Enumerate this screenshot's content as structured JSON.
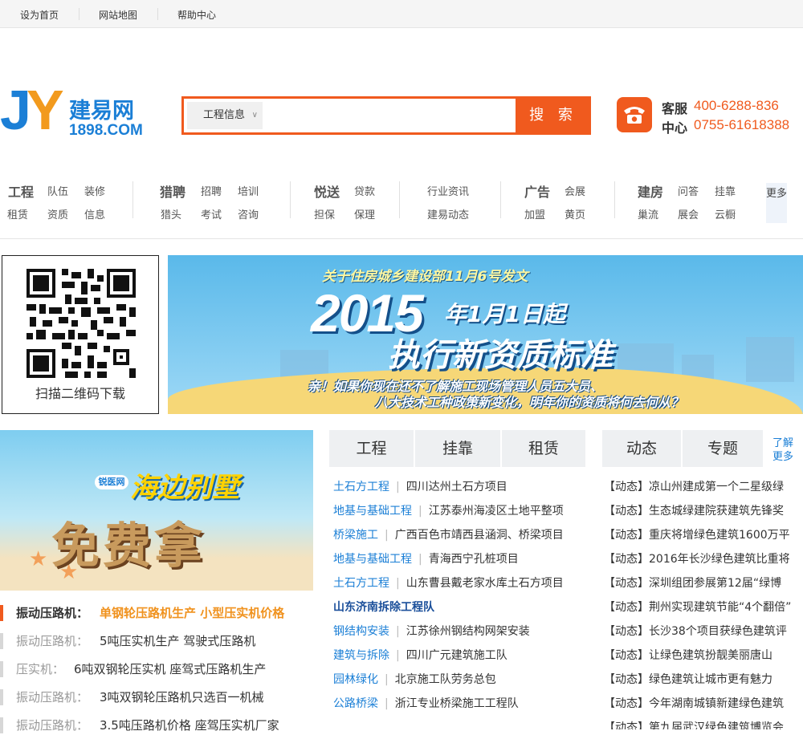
{
  "topbar": {
    "set_home": "设为首页",
    "sitemap": "网站地图",
    "help": "帮助中心"
  },
  "logo": {
    "mark_j": "J",
    "mark_y": "Y",
    "name_cn": "建易网",
    "name_en": "1898.COM"
  },
  "search": {
    "category": "工程信息",
    "placeholder": "",
    "button": "搜 索"
  },
  "service": {
    "label1": "客服",
    "label2": "中心",
    "tel1": "400-6288-836",
    "tel2": "0755-61618388"
  },
  "nav": {
    "groups": [
      {
        "head": "工程",
        "links": [
          "队伍",
          "装修",
          "租赁",
          "资质",
          "信息"
        ]
      },
      {
        "head": "猎聘",
        "links": [
          "招聘",
          "培训",
          "猎头",
          "考试",
          "咨询"
        ]
      },
      {
        "head": "悦送",
        "links": [
          "贷款",
          "担保",
          "保理"
        ]
      },
      {
        "head": "",
        "links": [
          "行业资讯",
          "建易动态"
        ]
      },
      {
        "head": "广告",
        "links": [
          "会展",
          "加盟",
          "黄页"
        ]
      },
      {
        "head": "建房",
        "links": [
          "问答",
          "挂靠",
          "巢流",
          "展会",
          "云橱"
        ]
      }
    ],
    "more": "更多"
  },
  "qr": {
    "caption": "扫描二维码下载"
  },
  "banner": {
    "line1": "关于住房城乡建设部11月6号发文",
    "year": "2015",
    "date": "年1月1日起",
    "headline": "执行新资质标准",
    "sub1": "亲！如果你现在还不了解施工现场管理人员五大员、",
    "sub2": "八大技术工种政策新变化，明年你的资质将何去何从？"
  },
  "promo": {
    "badge": "锐医网",
    "title1": "海边别墅",
    "title2": "免费拿"
  },
  "hot": [
    {
      "k": "振动压路机：",
      "v": "单钢轮压路机生产 小型压实机价格"
    },
    {
      "k": "振动压路机：",
      "v": "5吨压实机生产 驾驶式压路机"
    },
    {
      "k": "压实机：",
      "v": "6吨双钢轮压实机 座驾式压路机生产"
    },
    {
      "k": "振动压路机：",
      "v": "3吨双钢轮压路机只选百一机械"
    },
    {
      "k": "振动压路机：",
      "v": "3.5吨压路机价格 座驾压实机厂家"
    }
  ],
  "tabs_mid": [
    "工程",
    "挂靠",
    "租赁"
  ],
  "tabs_right": [
    "动态",
    "专题"
  ],
  "know_more": [
    "了解",
    "更多"
  ],
  "projects": [
    {
      "cat": "土石方工程",
      "txt": "四川达州土石方项目"
    },
    {
      "cat": "地基与基础工程",
      "txt": "江苏泰州海凌区土地平整项"
    },
    {
      "cat": "桥梁施工",
      "txt": "广西百色市靖西县涵洞、桥梁项目"
    },
    {
      "cat": "地基与基础工程",
      "txt": "青海西宁孔桩项目"
    },
    {
      "cat": "土石方工程",
      "txt": "山东曹县戴老家水库土石方项目"
    },
    {
      "cat": "",
      "txt": "山东济南拆除工程队"
    },
    {
      "cat": "钢结构安装",
      "txt": "江苏徐州钢结构网架安装"
    },
    {
      "cat": "建筑与拆除",
      "txt": "四川广元建筑施工队"
    },
    {
      "cat": "园林绿化",
      "txt": "北京施工队劳务总包"
    },
    {
      "cat": "公路桥梁",
      "txt": "浙江专业桥梁施工工程队"
    }
  ],
  "news": [
    "【动态】凉山州建成第一个二星级绿",
    "【动态】生态城绿建院获建筑先锋奖",
    "【动态】重庆将增绿色建筑1600万平",
    "【动态】2016年长沙绿色建筑比重将",
    "【动态】深圳组团参展第12届“绿博",
    "【动态】荆州实现建筑节能“4个翻倍”",
    "【动态】长沙38个项目获绿色建筑评",
    "【动态】让绿色建筑扮靓美丽唐山",
    "【动态】绿色建筑让城市更有魅力",
    "【动态】今年湖南城镇新建绿色建筑",
    "【动态】第九届武汉绿色建筑博览会"
  ],
  "colors": {
    "accent": "#f05a1e",
    "brand": "#1b7fd6"
  }
}
